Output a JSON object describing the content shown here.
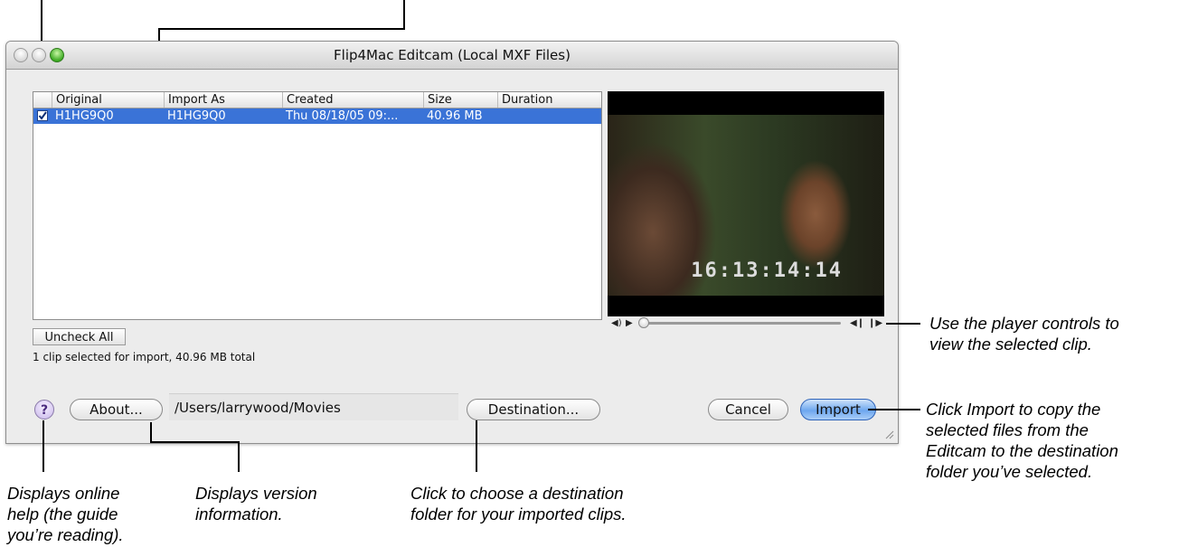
{
  "window": {
    "title": "Flip4Mac Editcam (Local MXF Files)"
  },
  "table": {
    "columns": [
      "Original",
      "Import As",
      "Created",
      "Size",
      "Duration"
    ],
    "rows": [
      {
        "checked": true,
        "original": "H1HG9Q0",
        "import_as": "H1HG9Q0",
        "created": "Thu 08/18/05 09:...",
        "size": "40.96 MB",
        "duration": ""
      }
    ]
  },
  "video": {
    "timecode": "16:13:14:14"
  },
  "buttons": {
    "uncheck_all": "Uncheck All",
    "help": "?",
    "about": "About...",
    "destination": "Destination...",
    "cancel": "Cancel",
    "import": "Import"
  },
  "status": {
    "text": "1 clip selected for import, 40.96 MB total"
  },
  "destination_path": "/Users/larrywood/Movies",
  "annotations": {
    "player": "Use the player controls to\nview the selected clip.",
    "import": "Click Import to copy the\nselected files from the\nEditcam to the destination\nfolder you’ve selected.",
    "help": "Displays online\nhelp (the guide\nyou’re reading).",
    "about": "Displays version\ninformation.",
    "destination": "Click to choose a destination\nfolder for your imported clips."
  },
  "colors": {
    "selection": "#3a73d7",
    "import_button": "#6da7ef"
  }
}
